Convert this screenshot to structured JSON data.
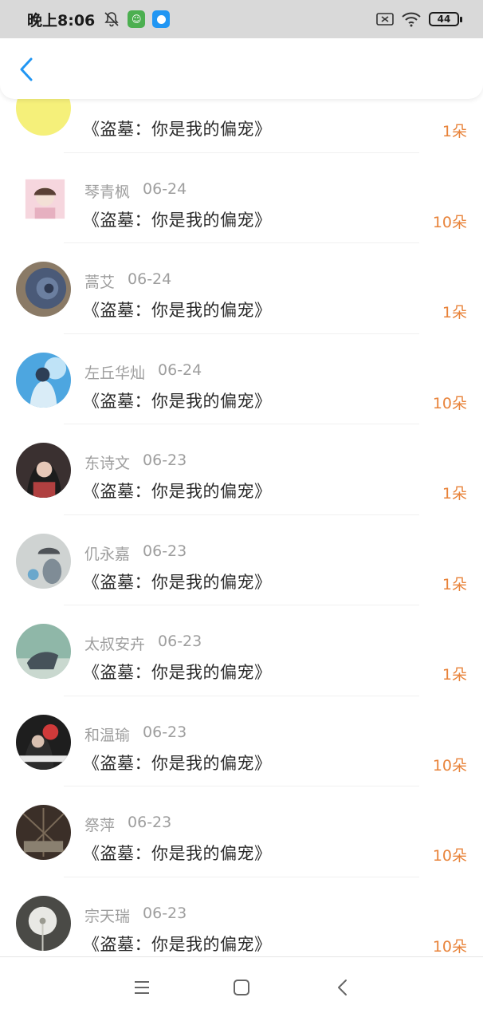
{
  "status": {
    "time": "晚上8:06",
    "battery": "44"
  },
  "header": {
    "back_icon": "chevron-left-icon"
  },
  "rows": [
    {
      "name": "",
      "date": "",
      "book": "《盗墓：你是我的偏宠》",
      "flowers": "1朵",
      "avatar_bg": "#f5f07a"
    },
    {
      "name": "琴青枫",
      "date": "06-24",
      "book": "《盗墓：你是我的偏宠》",
      "flowers": "10朵",
      "avatar_bg": "#f6d6de"
    },
    {
      "name": "蒿艾",
      "date": "06-24",
      "book": "《盗墓：你是我的偏宠》",
      "flowers": "1朵",
      "avatar_bg": "#4a5a78"
    },
    {
      "name": "左丘华灿",
      "date": "06-24",
      "book": "《盗墓：你是我的偏宠》",
      "flowers": "10朵",
      "avatar_bg": "#4da6e0"
    },
    {
      "name": "东诗文",
      "date": "06-23",
      "book": "《盗墓：你是我的偏宠》",
      "flowers": "1朵",
      "avatar_bg": "#3a3030"
    },
    {
      "name": "仉永嘉",
      "date": "06-23",
      "book": "《盗墓：你是我的偏宠》",
      "flowers": "1朵",
      "avatar_bg": "#cfd3d2"
    },
    {
      "name": "太叔安卉",
      "date": "06-23",
      "book": "《盗墓：你是我的偏宠》",
      "flowers": "1朵",
      "avatar_bg": "#8fb7a8"
    },
    {
      "name": "和温瑜",
      "date": "06-23",
      "book": "《盗墓：你是我的偏宠》",
      "flowers": "10朵",
      "avatar_bg": "#1e1e1e"
    },
    {
      "name": "祭萍",
      "date": "06-23",
      "book": "《盗墓：你是我的偏宠》",
      "flowers": "10朵",
      "avatar_bg": "#3b2f28"
    },
    {
      "name": "宗天瑞",
      "date": "06-23",
      "book": "《盗墓：你是我的偏宠》",
      "flowers": "10朵",
      "avatar_bg": "#4a4a46"
    }
  ],
  "colors": {
    "accent": "#e8833a",
    "back": "#2196f3",
    "meta": "#9e9e9e"
  }
}
